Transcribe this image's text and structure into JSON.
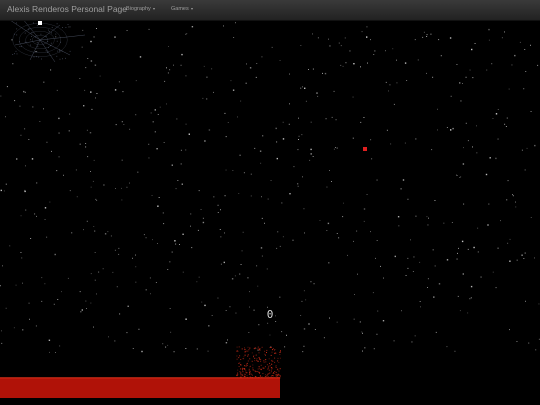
{
  "navbar": {
    "brand": "Alexis Renderos Personal Page",
    "items": [
      {
        "label": "Biography"
      },
      {
        "label": "Games"
      }
    ]
  },
  "game": {
    "score": "0",
    "colors": {
      "background": "#000000",
      "stars": "#cfcfcf",
      "player": "#ffffff",
      "enemy": "#e02020",
      "lava": "#b01208",
      "lava_edge": "#e0301a",
      "web": "#7f8aa6"
    }
  }
}
